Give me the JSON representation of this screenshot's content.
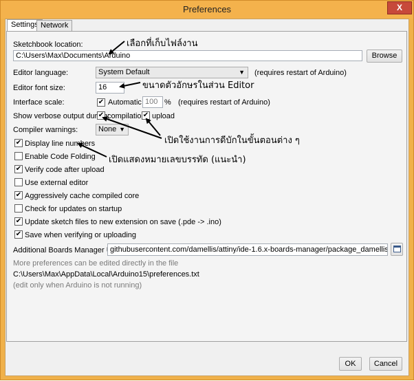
{
  "window": {
    "title": "Preferences",
    "close_glyph": "X"
  },
  "tabs": [
    {
      "label": "Settings",
      "active": true
    },
    {
      "label": "Network",
      "active": false
    }
  ],
  "sketchbook": {
    "label": "Sketchbook location:",
    "value": "C:\\Users\\Max\\Documents\\Arduino",
    "browse_label": "Browse"
  },
  "editor_language": {
    "label": "Editor language:",
    "value": "System Default",
    "note": "(requires restart of Arduino)"
  },
  "font_size": {
    "label": "Editor font size:",
    "value": "16"
  },
  "interface_scale": {
    "label": "Interface scale:",
    "automatic_label": "Automatic",
    "automatic_checked": true,
    "value": "100",
    "unit": "%",
    "note": "(requires restart of Arduino)"
  },
  "verbose": {
    "label": "Show verbose output during:",
    "compilation_label": "compilation",
    "compilation_checked": true,
    "upload_label": "upload",
    "upload_checked": true
  },
  "warnings": {
    "label": "Compiler warnings:",
    "value": "None"
  },
  "options": [
    {
      "label": "Display line numbers",
      "checked": true
    },
    {
      "label": "Enable Code Folding",
      "checked": false
    },
    {
      "label": "Verify code after upload",
      "checked": true
    },
    {
      "label": "Use external editor",
      "checked": false
    },
    {
      "label": "Aggressively cache compiled core",
      "checked": true
    },
    {
      "label": "Check for updates on startup",
      "checked": false
    },
    {
      "label": "Update sketch files to new extension on save (.pde -> .ino)",
      "checked": true
    },
    {
      "label": "Save when verifying or uploading",
      "checked": true
    }
  ],
  "boards_manager": {
    "label": "Additional Boards Manager URLs:",
    "value": "githubusercontent.com/damellis/attiny/ide-1.6.x-boards-manager/package_damellis_attiny_index.json"
  },
  "more_prefs": {
    "text": "More preferences can be edited directly in the file",
    "path": "C:\\Users\\Max\\AppData\\Local\\Arduino15\\preferences.txt",
    "note": "(edit only when Arduino is not running)"
  },
  "buttons": {
    "ok": "OK",
    "cancel": "Cancel"
  },
  "annotations": {
    "sketchbook": "เลือกที่เก็บไฟล์งาน",
    "font_size": "ขนาดตัวอักษรในส่วน Editor",
    "verbose": "เปิดใช้งานการดีบักในขั้นตอนต่าง ๆ",
    "line_numbers": "เปิดแสดงหมายเลขบรรทัด (แนะนำ)"
  },
  "colors": {
    "titlebar": "#f4b24c",
    "close_button": "#c7493a"
  }
}
